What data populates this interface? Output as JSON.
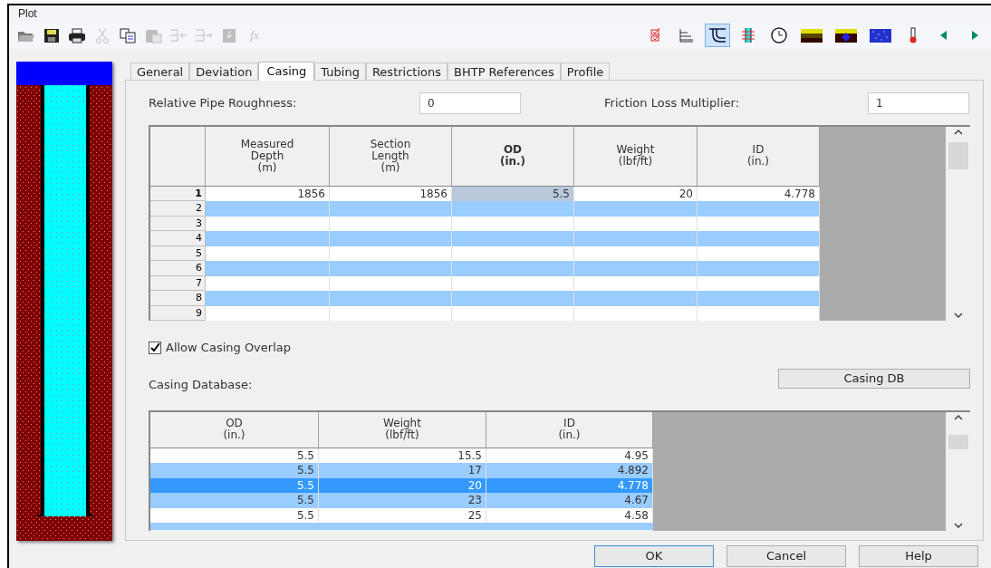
{
  "window": {
    "title": "Plot"
  },
  "toolbar": {
    "left": [
      {
        "kind": "open",
        "disabled": false
      },
      {
        "kind": "save",
        "disabled": false
      },
      {
        "kind": "print",
        "disabled": false
      },
      {
        "kind": "cut",
        "disabled": true
      },
      {
        "kind": "copy",
        "disabled": false
      },
      {
        "kind": "paste",
        "disabled": true
      },
      {
        "kind": "insert-row",
        "disabled": true
      },
      {
        "kind": "append-row",
        "disabled": true
      },
      {
        "kind": "import",
        "disabled": true
      },
      {
        "kind": "formula",
        "disabled": true,
        "label": "fx"
      }
    ],
    "right": [
      {
        "kind": "checklist",
        "selected": false
      },
      {
        "kind": "lines",
        "selected": false
      },
      {
        "kind": "pipe",
        "selected": true
      },
      {
        "kind": "perforation",
        "selected": false
      },
      {
        "kind": "clock",
        "selected": false
      },
      {
        "kind": "layers",
        "selected": false
      },
      {
        "kind": "reservoir",
        "selected": false
      },
      {
        "kind": "texture",
        "selected": false
      },
      {
        "kind": "thermometer",
        "selected": false
      },
      {
        "kind": "prev",
        "selected": false
      },
      {
        "kind": "next",
        "selected": false
      }
    ]
  },
  "tabs": [
    {
      "label": "General",
      "selected": false
    },
    {
      "label": "Deviation",
      "selected": false
    },
    {
      "label": "Casing",
      "selected": true
    },
    {
      "label": "Tubing",
      "selected": false
    },
    {
      "label": "Restrictions",
      "selected": false
    },
    {
      "label": "BHTP References",
      "selected": false
    },
    {
      "label": "Profile",
      "selected": false
    }
  ],
  "roughness": {
    "label": "Relative Pipe Roughness:",
    "value": "0"
  },
  "friction": {
    "label": "Friction Loss Multiplier:",
    "value": "1"
  },
  "casing_table": {
    "columns": [
      {
        "label": "Measured\nDepth\n(m)",
        "selected": false
      },
      {
        "label": "Section\nLength\n(m)",
        "selected": false
      },
      {
        "label": "OD\n(in.)",
        "selected": true
      },
      {
        "label": "Weight\n(lbf/ft)",
        "selected": false
      },
      {
        "label": "ID\n(in.)",
        "selected": false
      }
    ],
    "rows": [
      {
        "number": "1",
        "current": true,
        "cells": [
          "1856",
          "1856",
          "5.5",
          "20",
          "4.778"
        ]
      },
      {
        "number": "2",
        "current": false,
        "cells": []
      },
      {
        "number": "3",
        "current": false,
        "cells": []
      },
      {
        "number": "4",
        "current": false,
        "cells": []
      },
      {
        "number": "5",
        "current": false,
        "cells": []
      },
      {
        "number": "6",
        "current": false,
        "cells": []
      },
      {
        "number": "7",
        "current": false,
        "cells": []
      },
      {
        "number": "8",
        "current": false,
        "cells": []
      },
      {
        "number": "9",
        "current": false,
        "cells": []
      }
    ]
  },
  "allow_overlap": {
    "label": "Allow Casing Overlap",
    "checked": true
  },
  "database": {
    "label": "Casing Database:",
    "button": "Casing DB",
    "columns": [
      "OD\n(in.)",
      "Weight\n(lbf/ft)",
      "ID\n(in.)"
    ],
    "rows": [
      {
        "cells": [
          "5.5",
          "15.5",
          "4.95"
        ],
        "selected": false
      },
      {
        "cells": [
          "5.5",
          "17",
          "4.892"
        ],
        "selected": false
      },
      {
        "cells": [
          "5.5",
          "20",
          "4.778"
        ],
        "selected": true
      },
      {
        "cells": [
          "5.5",
          "23",
          "4.67"
        ],
        "selected": false
      },
      {
        "cells": [
          "5.5",
          "25",
          "4.58"
        ],
        "selected": false
      }
    ]
  },
  "buttons": [
    {
      "label": "OK",
      "default": true
    },
    {
      "label": "Cancel",
      "default": false
    },
    {
      "label": "Help",
      "default": false
    }
  ]
}
